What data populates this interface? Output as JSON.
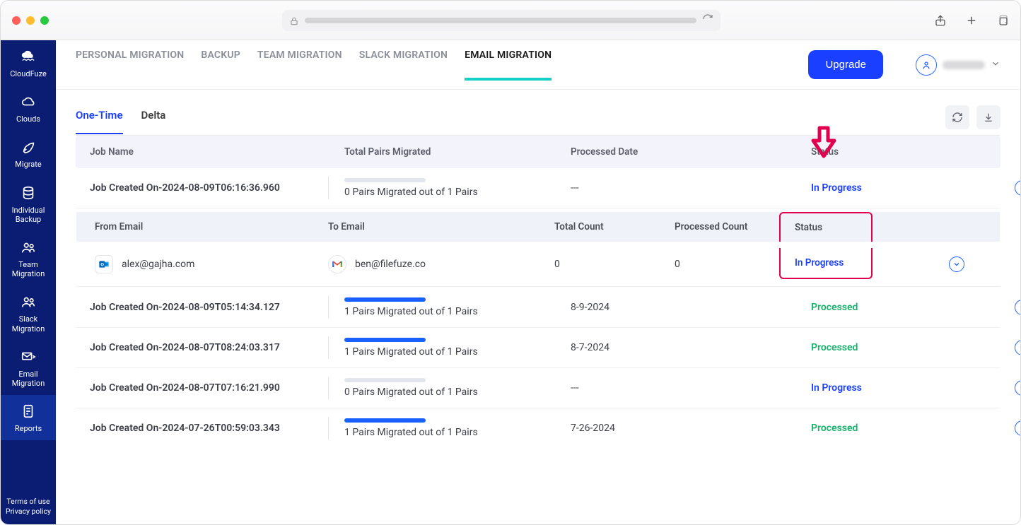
{
  "browser": {
    "chrome_icons": [
      "share",
      "add-tab",
      "tabs"
    ]
  },
  "sidebar": {
    "brand": "CloudFuze",
    "items": [
      {
        "key": "clouds",
        "label": "Clouds"
      },
      {
        "key": "migrate",
        "label": "Migrate"
      },
      {
        "key": "individual-backup",
        "label": "Individual\nBackup"
      },
      {
        "key": "team-migration",
        "label": "Team\nMigration"
      },
      {
        "key": "slack-migration",
        "label": "Slack\nMigration"
      },
      {
        "key": "email-migration",
        "label": "Email\nMigration"
      },
      {
        "key": "reports",
        "label": "Reports",
        "active": true
      }
    ],
    "footer": {
      "terms": "Terms of use",
      "privacy": "Privacy policy"
    }
  },
  "topbar": {
    "tabs": [
      {
        "label": "PERSONAL MIGRATION"
      },
      {
        "label": "BACKUP"
      },
      {
        "label": "TEAM MIGRATION"
      },
      {
        "label": "SLACK MIGRATION"
      },
      {
        "label": "EMAIL MIGRATION",
        "active": true
      }
    ],
    "upgrade_label": "Upgrade"
  },
  "subtabs": {
    "onetime": "One-Time",
    "delta": "Delta"
  },
  "table": {
    "headers": {
      "job": "Job Name",
      "pairs": "Total Pairs Migrated",
      "date": "Processed Date",
      "status": "Status"
    },
    "sub_headers": {
      "from": "From Email",
      "to": "To Email",
      "total": "Total Count",
      "processed": "Processed Count",
      "status": "Status"
    },
    "rows": [
      {
        "job": "Job Created On-2024-08-09T06:16:36.960",
        "pairs": "0 Pairs Migrated out of 1 Pairs",
        "progress": 0,
        "date": "---",
        "status": "In Progress",
        "status_class": "inprog",
        "expanded": true,
        "detail": {
          "from": "alex@gajha.com",
          "to": "ben@filefuze.co",
          "total": "0",
          "processed": "0",
          "status": "In Progress"
        }
      },
      {
        "job": "Job Created On-2024-08-09T05:14:34.127",
        "pairs": "1 Pairs Migrated out of 1 Pairs",
        "progress": 100,
        "date": "8-9-2024",
        "status": "Processed",
        "status_class": "proc"
      },
      {
        "job": "Job Created On-2024-08-07T08:24:03.317",
        "pairs": "1 Pairs Migrated out of 1 Pairs",
        "progress": 100,
        "date": "8-7-2024",
        "status": "Processed",
        "status_class": "proc"
      },
      {
        "job": "Job Created On-2024-08-07T07:16:21.990",
        "pairs": "0 Pairs Migrated out of 1 Pairs",
        "progress": 0,
        "date": "---",
        "status": "In Progress",
        "status_class": "inprog"
      },
      {
        "job": "Job Created On-2024-07-26T00:59:03.343",
        "pairs": "1 Pairs Migrated out of 1 Pairs",
        "progress": 100,
        "date": "7-26-2024",
        "status": "Processed",
        "status_class": "proc"
      }
    ]
  }
}
